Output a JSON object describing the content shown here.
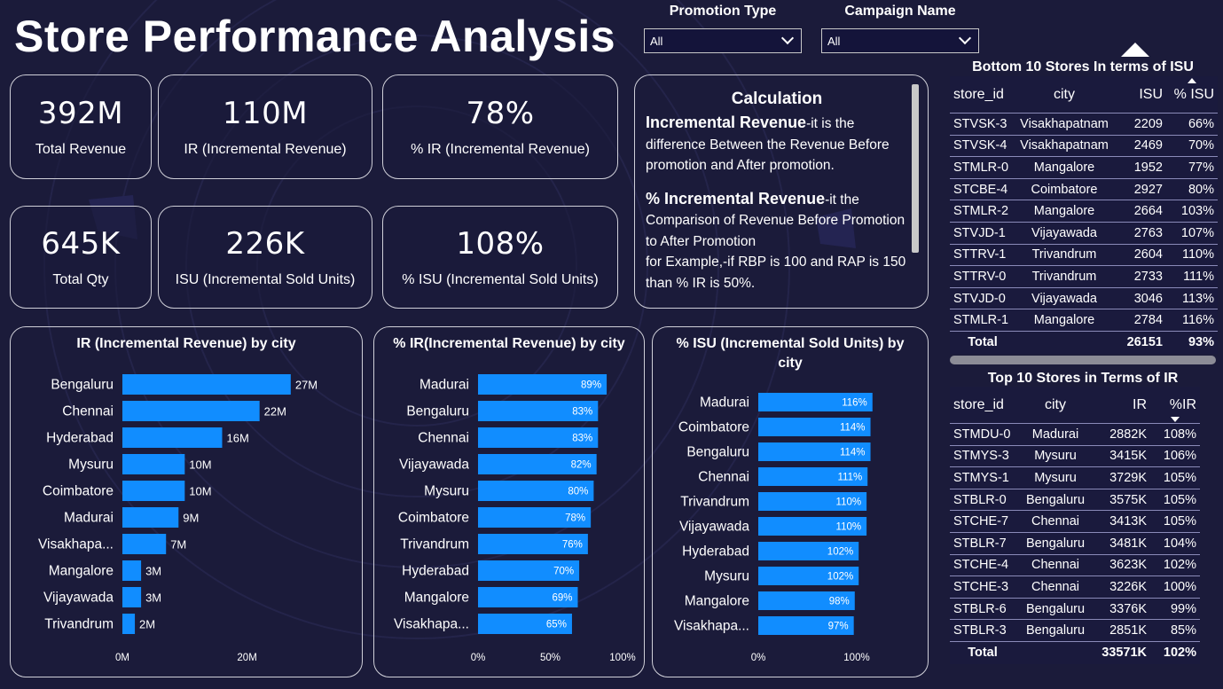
{
  "title": "Store Performance Analysis",
  "filters": [
    {
      "label": "Promotion Type",
      "value": "All"
    },
    {
      "label": "Campaign Name",
      "value": "All"
    }
  ],
  "kpis": [
    {
      "value": "392M",
      "label": "Total Revenue"
    },
    {
      "value": "110M",
      "label": "IR (Incremental Revenue)"
    },
    {
      "value": "78%",
      "label": "% IR (Incremental Revenue)"
    },
    {
      "value": "645K",
      "label": "Total Qty"
    },
    {
      "value": "226K",
      "label": "ISU (Incremental Sold Units)"
    },
    {
      "value": "108%",
      "label": "% ISU (Incremental Sold Units)"
    }
  ],
  "calculation": {
    "title": "Calculation",
    "ir_heading": "Incremental Revenue",
    "ir_text": "-it is the difference Between the Revenue Before promotion and After promotion.",
    "pir_heading": "% Incremental Revenue",
    "pir_text": "-it the Comparison of Revenue Before Promotion to After Promotion",
    "example": "for Example,-if RBP is 100 and RAP is 150 than % IR is 50%."
  },
  "colors": {
    "bar": "#118dff",
    "background": "#1b1b3a",
    "border": "#cfcfd8"
  },
  "chart_data": [
    {
      "type": "bar",
      "orientation": "horizontal",
      "title": "IR (Incremental Revenue) by city",
      "categories": [
        "Bengaluru",
        "Chennai",
        "Hyderabad",
        "Mysuru",
        "Coimbatore",
        "Madurai",
        "Visakhapa...",
        "Mangalore",
        "Vijayawada",
        "Trivandrum"
      ],
      "values": [
        27,
        22,
        16,
        10,
        10,
        9,
        7,
        3,
        3,
        2
      ],
      "labels": [
        "27M",
        "22M",
        "16M",
        "10M",
        "10M",
        "9M",
        "7M",
        "3M",
        "3M",
        "2M"
      ],
      "xlim": [
        0,
        33
      ],
      "xticks": [
        0,
        20
      ],
      "xtick_labels": [
        "0M",
        "20M"
      ]
    },
    {
      "type": "bar",
      "orientation": "horizontal",
      "title": "% IR(Incremental Revenue) by city",
      "categories": [
        "Madurai",
        "Bengaluru",
        "Chennai",
        "Vijayawada",
        "Mysuru",
        "Coimbatore",
        "Trivandrum",
        "Hyderabad",
        "Mangalore",
        "Visakhapa..."
      ],
      "values": [
        89,
        83,
        83,
        82,
        80,
        78,
        76,
        70,
        69,
        65
      ],
      "labels": [
        "89%",
        "83%",
        "83%",
        "82%",
        "80%",
        "78%",
        "76%",
        "70%",
        "69%",
        "65%"
      ],
      "xlim": [
        0,
        100
      ],
      "xticks": [
        0,
        50,
        100
      ],
      "xtick_labels": [
        "0%",
        "50%",
        "100%"
      ]
    },
    {
      "type": "bar",
      "orientation": "horizontal",
      "title": "% ISU (Incremental Sold Units) by city",
      "title_lines": [
        "% ISU (Incremental Sold Units) by",
        "city"
      ],
      "categories": [
        "Madurai",
        "Coimbatore",
        "Bengaluru",
        "Chennai",
        "Trivandrum",
        "Vijayawada",
        "Hyderabad",
        "Mysuru",
        "Mangalore",
        "Visakhapa..."
      ],
      "values": [
        116,
        114,
        114,
        111,
        110,
        110,
        102,
        102,
        98,
        97
      ],
      "labels": [
        "116%",
        "114%",
        "114%",
        "111%",
        "110%",
        "110%",
        "102%",
        "102%",
        "98%",
        "97%"
      ],
      "xlim": [
        0,
        100
      ],
      "xticks": [
        0,
        100
      ],
      "xtick_labels": [
        "0%",
        "100%"
      ]
    }
  ],
  "bottom_table": {
    "title": "Bottom 10 Stores In terms of ISU",
    "columns": [
      "store_id",
      "city",
      "ISU",
      "% ISU"
    ],
    "rows": [
      [
        "STVSK-3",
        "Visakhapatnam",
        "2209",
        "66%"
      ],
      [
        "STVSK-4",
        "Visakhapatnam",
        "2469",
        "70%"
      ],
      [
        "STMLR-0",
        "Mangalore",
        "1952",
        "77%"
      ],
      [
        "STCBE-4",
        "Coimbatore",
        "2927",
        "80%"
      ],
      [
        "STMLR-2",
        "Mangalore",
        "2664",
        "103%"
      ],
      [
        "STVJD-1",
        "Vijayawada",
        "2763",
        "107%"
      ],
      [
        "STTRV-1",
        "Trivandrum",
        "2604",
        "110%"
      ],
      [
        "STTRV-0",
        "Trivandrum",
        "2733",
        "111%"
      ],
      [
        "STVJD-0",
        "Vijayawada",
        "3046",
        "113%"
      ],
      [
        "STMLR-1",
        "Mangalore",
        "2784",
        "116%"
      ]
    ],
    "total": [
      "Total",
      "",
      "26151",
      "93%"
    ]
  },
  "top_table": {
    "title": "Top 10 Stores in Terms of IR",
    "columns": [
      "store_id",
      "city",
      "IR",
      "%IR"
    ],
    "rows": [
      [
        "STMDU-0",
        "Madurai",
        "2882K",
        "108%"
      ],
      [
        "STMYS-3",
        "Mysuru",
        "3415K",
        "106%"
      ],
      [
        "STMYS-1",
        "Mysuru",
        "3729K",
        "105%"
      ],
      [
        "STBLR-0",
        "Bengaluru",
        "3575K",
        "105%"
      ],
      [
        "STCHE-7",
        "Chennai",
        "3413K",
        "105%"
      ],
      [
        "STBLR-7",
        "Bengaluru",
        "3481K",
        "104%"
      ],
      [
        "STCHE-4",
        "Chennai",
        "3623K",
        "102%"
      ],
      [
        "STCHE-3",
        "Chennai",
        "3226K",
        "100%"
      ],
      [
        "STBLR-6",
        "Bengaluru",
        "3376K",
        "99%"
      ],
      [
        "STBLR-3",
        "Bengaluru",
        "2851K",
        "85%"
      ]
    ],
    "total": [
      "Total",
      "",
      "33571K",
      "102%"
    ]
  }
}
